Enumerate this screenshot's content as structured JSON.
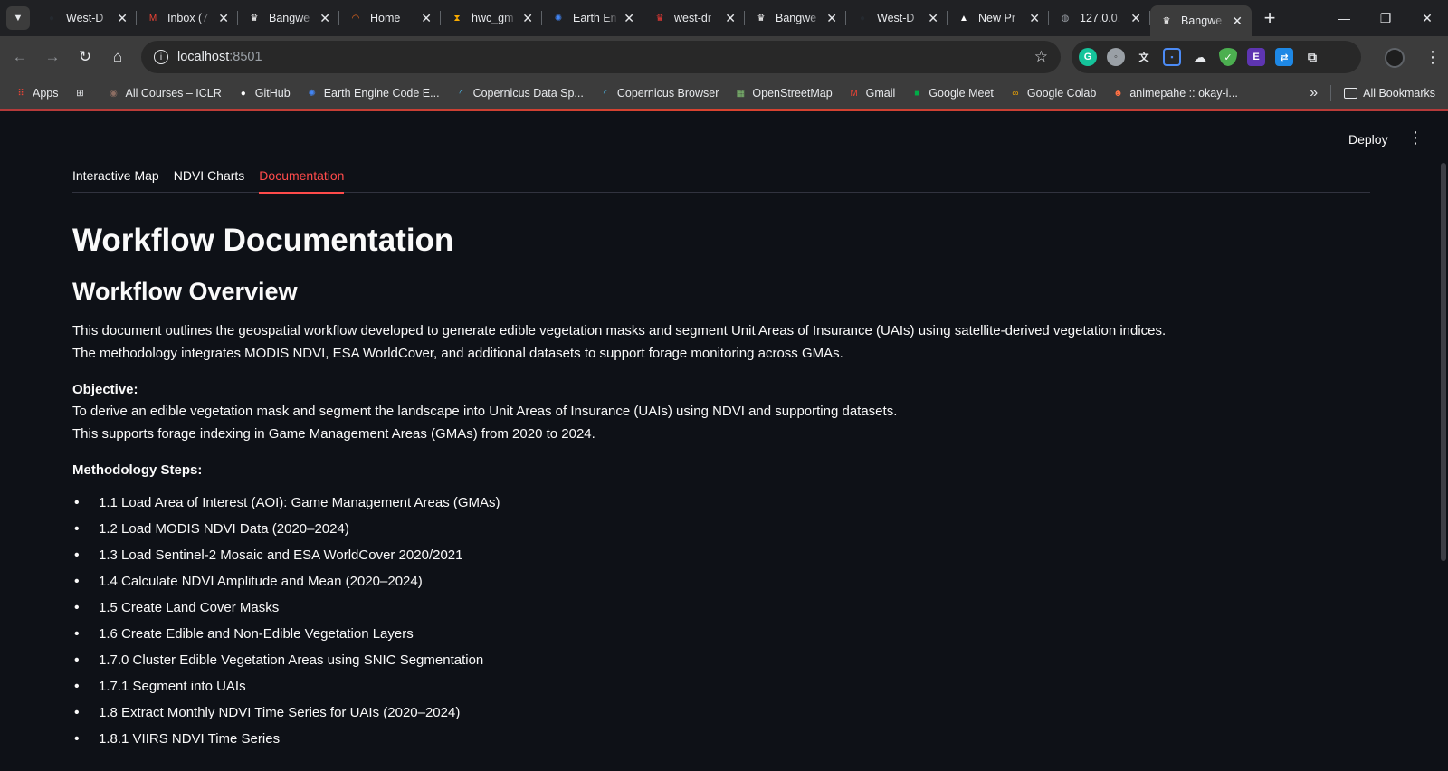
{
  "browser": {
    "tabs": [
      {
        "title": "West-D",
        "icon": "github-icon",
        "color": "#24292f",
        "glyph": "●",
        "active": false
      },
      {
        "title": "Inbox (7",
        "icon": "gmail-icon",
        "color": "#ea4335",
        "glyph": "M",
        "active": false
      },
      {
        "title": "Bangwe",
        "icon": "crown-icon",
        "color": "#ffffff",
        "glyph": "♛",
        "active": false
      },
      {
        "title": "Home",
        "icon": "orange-arc-icon",
        "color": "#f26b1d",
        "glyph": "◠",
        "active": false
      },
      {
        "title": "hwc_gm",
        "icon": "hourglass-icon",
        "color": "#f9ab00",
        "glyph": "⧗",
        "active": false
      },
      {
        "title": "Earth En",
        "icon": "earth-engine-icon",
        "color": "#4285f4",
        "glyph": "✺",
        "active": false
      },
      {
        "title": "west-dr",
        "icon": "red-crown-icon",
        "color": "#e53935",
        "glyph": "♛",
        "active": false
      },
      {
        "title": "Bangwe",
        "icon": "crown-icon",
        "color": "#ffffff",
        "glyph": "♛",
        "active": false
      },
      {
        "title": "West-D",
        "icon": "github-icon",
        "color": "#24292f",
        "glyph": "●",
        "active": false
      },
      {
        "title": "New Pr",
        "icon": "triangle-icon",
        "color": "#ffffff",
        "glyph": "▲",
        "active": false
      },
      {
        "title": "127.0.0.",
        "icon": "globe-icon",
        "color": "#9aa0a6",
        "glyph": "◍",
        "active": false
      },
      {
        "title": "Bangwe",
        "icon": "crown-icon",
        "color": "#ffffff",
        "glyph": "♛",
        "active": true
      }
    ],
    "url_host": "localhost",
    "url_port": ":8501",
    "bookmarks": [
      {
        "label": "Apps",
        "icon": "apps-grid-icon",
        "color": "#ea4335",
        "glyph": "⠿"
      },
      {
        "label": "",
        "icon": "tab-groups-icon",
        "color": "#e8eaed",
        "glyph": "⊞"
      },
      {
        "label": "All Courses – ICLR",
        "icon": "iclr-icon",
        "color": "#8d6e63",
        "glyph": "◉"
      },
      {
        "label": "GitHub",
        "icon": "github-icon",
        "color": "#ffffff",
        "glyph": "●"
      },
      {
        "label": "Earth Engine Code E...",
        "icon": "earth-engine-icon",
        "color": "#4285f4",
        "glyph": "✺"
      },
      {
        "label": "Copernicus Data Sp...",
        "icon": "copernicus-icon",
        "color": "#4fc3f7",
        "glyph": "◜"
      },
      {
        "label": "Copernicus Browser",
        "icon": "copernicus-icon",
        "color": "#4fc3f7",
        "glyph": "◜"
      },
      {
        "label": "OpenStreetMap",
        "icon": "osm-icon",
        "color": "#7ebc6f",
        "glyph": "▦"
      },
      {
        "label": "Gmail",
        "icon": "gmail-icon",
        "color": "#ea4335",
        "glyph": "M"
      },
      {
        "label": "Google Meet",
        "icon": "meet-icon",
        "color": "#00ac47",
        "glyph": "■"
      },
      {
        "label": "Google Colab",
        "icon": "colab-icon",
        "color": "#f9ab00",
        "glyph": "∞"
      },
      {
        "label": "animepahe :: okay-i...",
        "icon": "anime-icon",
        "color": "#ff7043",
        "glyph": "☻"
      }
    ],
    "all_bookmarks": "All Bookmarks"
  },
  "app": {
    "deploy_label": "Deploy",
    "tabs": [
      {
        "label": "Interactive Map",
        "active": false
      },
      {
        "label": "NDVI Charts",
        "active": false
      },
      {
        "label": "Documentation",
        "active": true
      }
    ],
    "page_title": "Workflow Documentation",
    "section_title": "Workflow Overview",
    "intro": [
      "This document outlines the geospatial workflow developed to generate edible vegetation masks and segment Unit Areas of Insurance (UAIs) using satellite-derived vegetation indices.",
      "The methodology integrates MODIS NDVI, ESA WorldCover, and additional datasets to support forage monitoring across GMAs."
    ],
    "objective_label": "Objective:",
    "objective": [
      "To derive an edible vegetation mask and segment the landscape into Unit Areas of Insurance (UAIs) using NDVI and supporting datasets.",
      "This supports forage indexing in Game Management Areas (GMAs) from 2020 to 2024."
    ],
    "steps_label": "Methodology Steps:",
    "steps": [
      "1.1 Load Area of Interest (AOI): Game Management Areas (GMAs)",
      "1.2 Load MODIS NDVI Data (2020–2024)",
      "1.3 Load Sentinel-2 Mosaic and ESA WorldCover 2020/2021",
      "1.4 Calculate NDVI Amplitude and Mean (2020–2024)",
      "1.5 Create Land Cover Masks",
      "1.6 Create Edible and Non-Edible Vegetation Layers",
      "1.7.0 Cluster Edible Vegetation Areas using SNIC Segmentation",
      "1.7.1 Segment into UAIs",
      "1.8 Extract Monthly NDVI Time Series for UAIs (2020–2024)",
      "1.8.1 VIIRS NDVI Time Series"
    ],
    "accent": "#ff4b4b",
    "background": "#0e1117"
  }
}
